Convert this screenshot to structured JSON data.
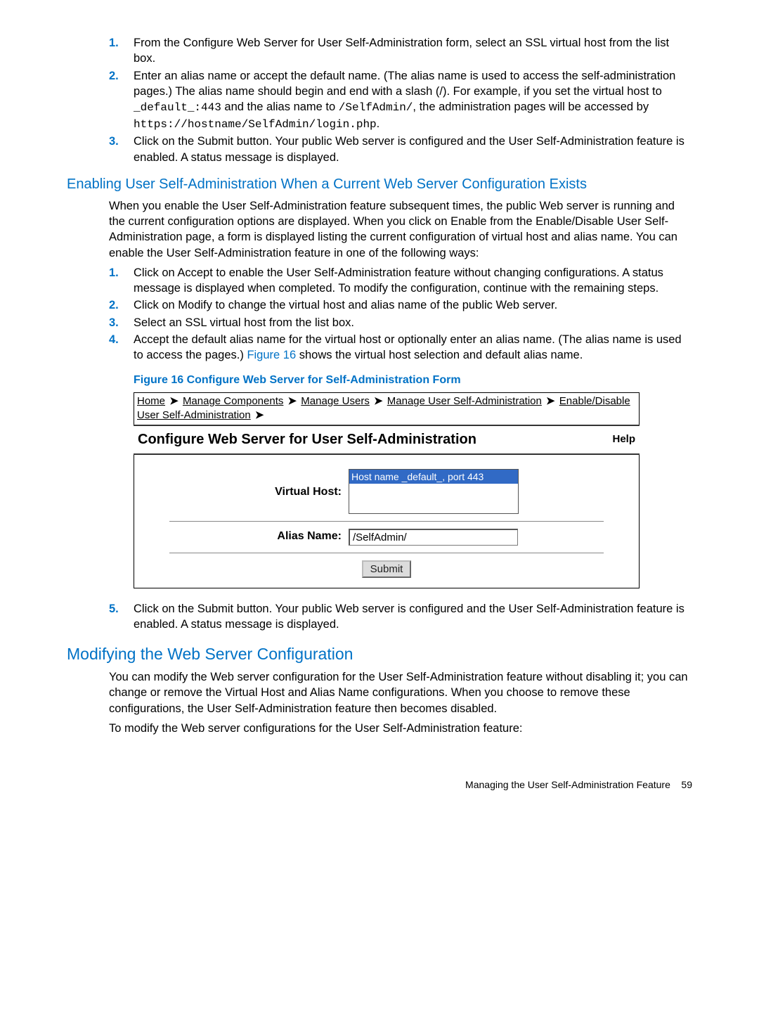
{
  "list1": {
    "items": [
      {
        "num": "1.",
        "segments": [
          {
            "t": "text",
            "v": "From the Configure Web Server for User Self-Administration form, select an SSL virtual host from the list box."
          }
        ]
      },
      {
        "num": "2.",
        "segments": [
          {
            "t": "text",
            "v": "Enter an alias name or accept the default name. (The alias name is used to access the self-administration pages.) The alias name should begin and end with a slash (/). For example, if you set the virtual host to "
          },
          {
            "t": "code",
            "v": "_default_:443"
          },
          {
            "t": "text",
            "v": " and the alias name to "
          },
          {
            "t": "code",
            "v": "/SelfAdmin/"
          },
          {
            "t": "text",
            "v": ", the administration pages will be accessed by "
          },
          {
            "t": "code",
            "v": "https://hostname/SelfAdmin/login.php"
          },
          {
            "t": "text",
            "v": "."
          }
        ]
      },
      {
        "num": "3.",
        "segments": [
          {
            "t": "text",
            "v": "Click on the Submit button. Your public Web server is configured and the User Self-Administration feature is enabled. A status message is displayed."
          }
        ]
      }
    ]
  },
  "subheading1": "Enabling User Self-Administration When a Current Web Server Configuration Exists",
  "para1": "When you enable the User Self-Administration feature subsequent times, the public Web server is running and the current configuration options are displayed. When you click on Enable from the Enable/Disable User Self-Administration page, a form is displayed listing the current configuration of virtual host and alias name. You can enable the User Self-Administration feature in one of the following ways:",
  "list2": {
    "items": [
      {
        "num": "1.",
        "segments": [
          {
            "t": "text",
            "v": "Click on Accept to enable the User Self-Administration feature without changing configurations. A status message is displayed when completed. To modify the configuration, continue with the remaining steps."
          }
        ]
      },
      {
        "num": "2.",
        "segments": [
          {
            "t": "text",
            "v": "Click on Modify to change the virtual host and alias name of the public Web server."
          }
        ]
      },
      {
        "num": "3.",
        "segments": [
          {
            "t": "text",
            "v": "Select an SSL virtual host from the list box."
          }
        ]
      },
      {
        "num": "4.",
        "segments": [
          {
            "t": "text",
            "v": "Accept the default alias name for the virtual host or optionally enter an alias name. (The alias name is used to access the pages.) "
          },
          {
            "t": "figref",
            "v": "Figure 16"
          },
          {
            "t": "text",
            "v": " shows the virtual host selection and default alias name."
          }
        ]
      }
    ]
  },
  "figcaption": "Figure 16 Configure Web Server for Self-Administration Form",
  "figure": {
    "breadcrumb": {
      "items": [
        "Home",
        "Manage Components",
        "Manage Users",
        "Manage User Self-Administration",
        "Enable/Disable User Self-Administration"
      ],
      "sep_glyph": "➤"
    },
    "title": "Configure Web Server for User Self-Administration",
    "help": "Help",
    "vh_label": "Virtual Host:",
    "vh_option": "Host name _default_, port 443",
    "alias_label": "Alias Name:",
    "alias_value": "/SelfAdmin/",
    "submit": "Submit"
  },
  "list3": {
    "items": [
      {
        "num": "5.",
        "segments": [
          {
            "t": "text",
            "v": "Click on the Submit button. Your public Web server is configured and the User Self-Administration feature is enabled. A status message is displayed."
          }
        ]
      }
    ]
  },
  "sectionheading": "Modifying the Web Server Configuration",
  "para2": "You can modify the Web server configuration for the User Self-Administration feature without disabling it; you can change or remove the Virtual Host and Alias Name configurations. When you choose to remove these configurations, the User Self-Administration feature then becomes disabled.",
  "para3": "To modify the Web server configurations for the User Self-Administration feature:",
  "footer": {
    "text": "Managing the User Self-Administration Feature",
    "page": "59"
  }
}
